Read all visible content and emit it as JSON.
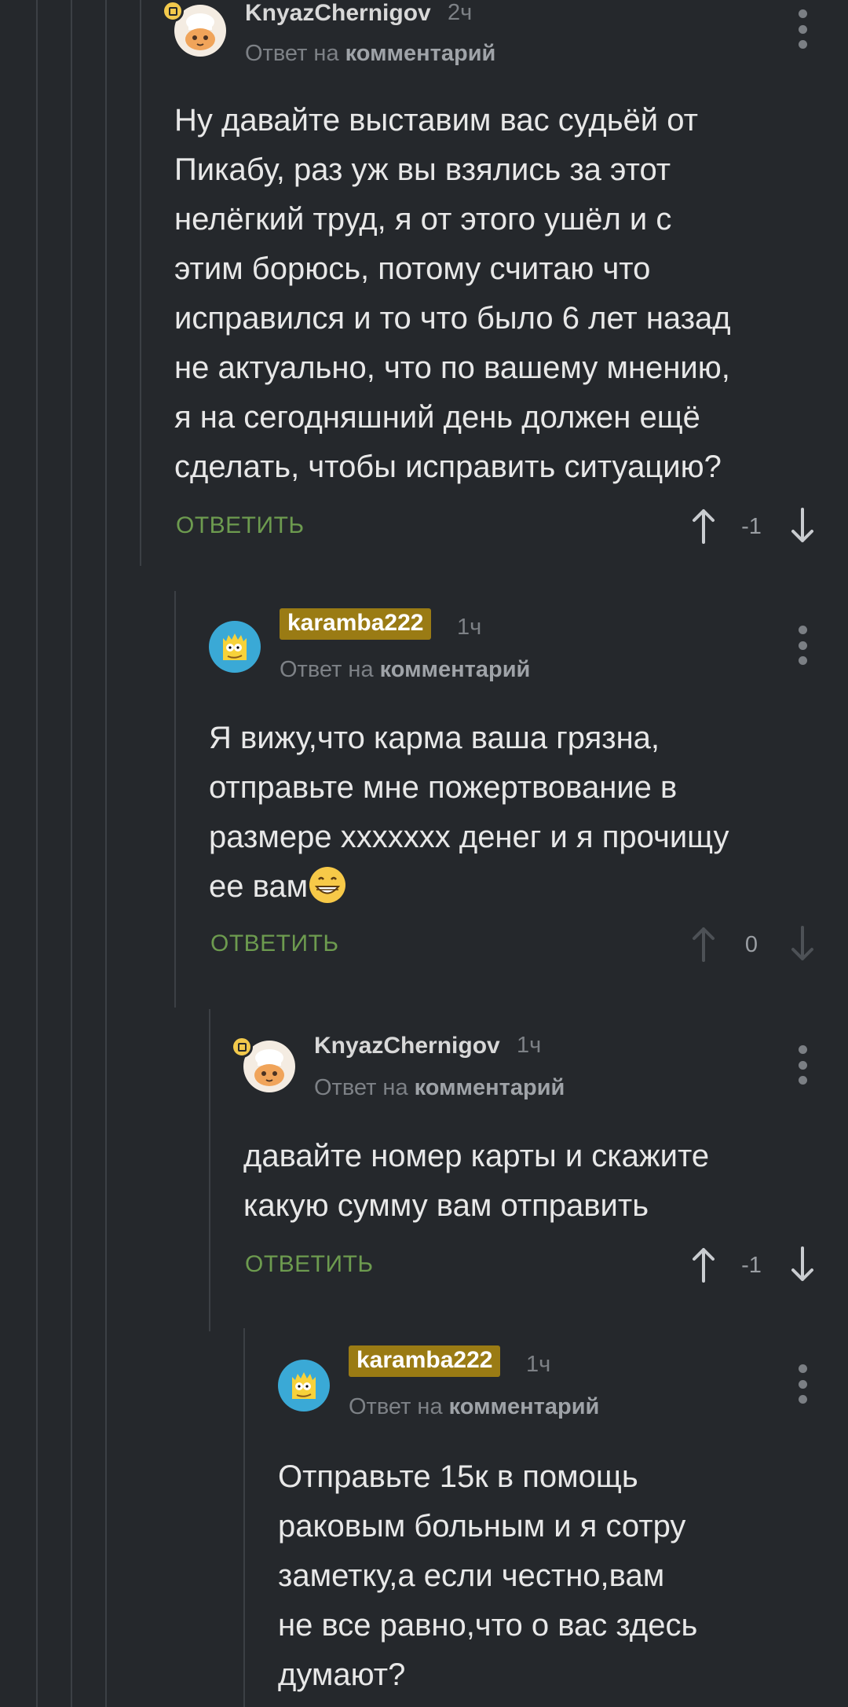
{
  "comments": [
    {
      "username": "KnyazChernigov",
      "time": "2ч",
      "reply_prefix": "Ответ на",
      "reply_link": "комментарий",
      "body": "Ну давайте выставим вас судьёй от\nПикабу, раз уж вы взялись за этот\nнелёгкий труд, я от этого ушёл и с\nэтим борюсь, потому считаю что\nисправился и то что было 6 лет назад\nне актуально, что по вашему мнению,\nя на сегодняшний день должен ещё\nсделать, чтобы исправить ситуацию?",
      "reply_label": "ОТВЕТИТЬ",
      "rating": "-1",
      "avatar": "chef-cat-avatar"
    },
    {
      "username": "karamba222",
      "time": "1ч",
      "reply_prefix": "Ответ на",
      "reply_link": "комментарий",
      "body": "Я вижу,что карма ваша грязна,\nотправьте мне пожертвование в\nразмере ххххххх денег и я прочищу\nее вам",
      "body_emoji": "grinning-face-emoji",
      "reply_label": "ОТВЕТИТЬ",
      "rating": "0",
      "avatar": "bart-avatar"
    },
    {
      "username": "KnyazChernigov",
      "time": "1ч",
      "reply_prefix": "Ответ на",
      "reply_link": "комментарий",
      "body": "давайте номер карты и скажите\nкакую сумму вам отправить",
      "reply_label": "ОТВЕТИТЬ",
      "rating": "-1",
      "avatar": "chef-cat-avatar"
    },
    {
      "username": "karamba222",
      "time": "1ч",
      "reply_prefix": "Ответ на",
      "reply_link": "комментарий",
      "body": "Отправьте 15к в помощь\nраковым больным и я сотру\nзаметку,а если честно,вам\nне все равно,что о вас здесь\nдумают?",
      "avatar": "bart-avatar"
    }
  ],
  "colors": {
    "background": "#25282c",
    "reply_green": "#6d9b4f",
    "author_highlight": "#9a7b14",
    "badge": "#f2c94c"
  }
}
